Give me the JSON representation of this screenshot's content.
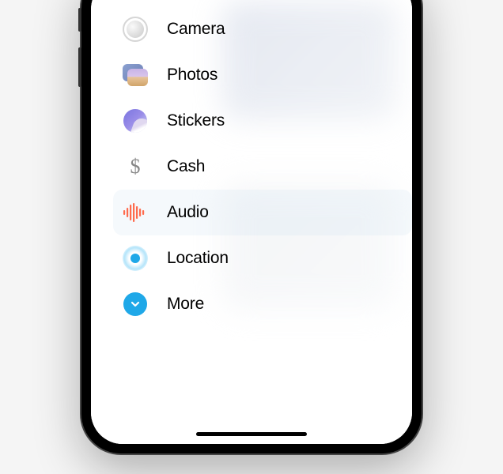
{
  "menu": {
    "items": [
      {
        "id": "camera",
        "label": "Camera",
        "highlighted": false
      },
      {
        "id": "photos",
        "label": "Photos",
        "highlighted": false
      },
      {
        "id": "stickers",
        "label": "Stickers",
        "highlighted": false
      },
      {
        "id": "cash",
        "label": "Cash",
        "highlighted": false
      },
      {
        "id": "audio",
        "label": "Audio",
        "highlighted": true
      },
      {
        "id": "location",
        "label": "Location",
        "highlighted": false
      },
      {
        "id": "more",
        "label": "More",
        "highlighted": false
      }
    ]
  }
}
